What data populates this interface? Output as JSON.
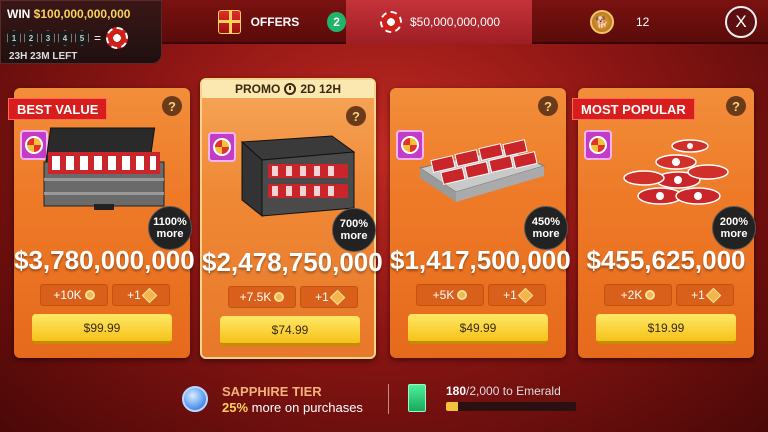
{
  "jackpot": {
    "win_prefix": "WIN",
    "win_amount": "$100,000,000,000",
    "balls": [
      "1",
      "2",
      "3",
      "4",
      "5"
    ],
    "equals": "=",
    "time_left": "23H 23M LEFT"
  },
  "header": {
    "offers_label": "OFFERS",
    "offers_count": "2",
    "chip_balance": "$50,000,000,000",
    "tickets": "12",
    "close_label": "X"
  },
  "cards": [
    {
      "ribbon": "BEST VALUE",
      "promo": "",
      "help": "?",
      "more_pct": "1100%",
      "more_word": "more",
      "amount": "$3,780,000,000",
      "bonus_a": "+10K",
      "bonus_b": "+1",
      "price": "$99.99"
    },
    {
      "ribbon": "",
      "promo_label": "PROMO",
      "promo_time": "2D 12H",
      "help": "?",
      "more_pct": "700%",
      "more_word": "more",
      "amount": "$2,478,750,000",
      "bonus_a": "+7.5K",
      "bonus_b": "+1",
      "price": "$74.99"
    },
    {
      "ribbon": "",
      "promo": "",
      "help": "?",
      "more_pct": "450%",
      "more_word": "more",
      "amount": "$1,417,500,000",
      "bonus_a": "+5K",
      "bonus_b": "+1",
      "price": "$49.99"
    },
    {
      "ribbon": "MOST POPULAR",
      "promo": "",
      "help": "?",
      "more_pct": "200%",
      "more_word": "more",
      "amount": "$455,625,000",
      "bonus_a": "+2K",
      "bonus_b": "+1",
      "price": "$19.99"
    }
  ],
  "tier": {
    "name": "SAPPHIRE TIER",
    "perk_pct": "25%",
    "perk_text": "more on purchases",
    "progress_current": "180",
    "progress_rest": "/2,000 to Emerald",
    "progress_fraction": 0.09
  },
  "colors": {
    "background": "#a01d18",
    "card": "#ee7a28",
    "buy_button": "#f6c21a",
    "ribbon": "#d81d1d",
    "progress": "#f2c23a"
  }
}
